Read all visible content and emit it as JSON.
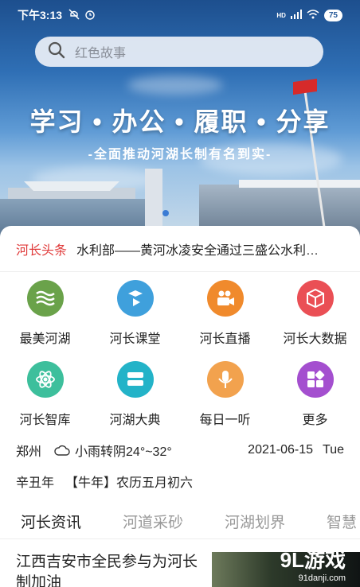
{
  "status_bar": {
    "time": "下午3:13",
    "battery": "75",
    "network": "HD"
  },
  "search": {
    "placeholder": "红色故事"
  },
  "banner": {
    "slogan": "学习 • 办公 • 履职 • 分享",
    "subslogan": "-全面推动河湖长制有名到实-"
  },
  "news_ticker": {
    "tag": "河长头条",
    "text": "水利部——黄河冰凌安全通过三盛公水利…"
  },
  "features": [
    {
      "label": "最美河湖",
      "icon": "waves-icon",
      "color": "#6aa24a"
    },
    {
      "label": "河长课堂",
      "icon": "play-icon",
      "color": "#3fa0dc"
    },
    {
      "label": "河长直播",
      "icon": "video-icon",
      "color": "#f08a2c"
    },
    {
      "label": "河长大数据",
      "icon": "cube-icon",
      "color": "#ea4f55"
    },
    {
      "label": "河长智库",
      "icon": "atom-icon",
      "color": "#3dbf9c"
    },
    {
      "label": "河湖大典",
      "icon": "book-icon",
      "color": "#23b3c8"
    },
    {
      "label": "每日一听",
      "icon": "microphone-icon",
      "color": "#f2a24e"
    },
    {
      "label": "更多",
      "icon": "grid-icon",
      "color": "#a44fcf"
    }
  ],
  "weather": {
    "city": "郑州",
    "condition": "小雨转阴24°~32°",
    "date": "2021-06-15",
    "weekday": "Tue"
  },
  "lunar": {
    "year": "辛丑年",
    "zodiac": "【牛年】",
    "date": "农历五月初六"
  },
  "tabs": [
    {
      "label": "河长资讯",
      "active": true
    },
    {
      "label": "河道采砂",
      "active": false
    },
    {
      "label": "河湖划界",
      "active": false
    },
    {
      "label": "智慧",
      "active": false
    }
  ],
  "article": {
    "title": "江西吉安市全民参与为河长制加油"
  },
  "watermark": {
    "main": "9L游戏",
    "sub": "91danji.com"
  },
  "colors": {
    "accent": "#e03a3a",
    "active_dot": "#3b7bd4"
  }
}
